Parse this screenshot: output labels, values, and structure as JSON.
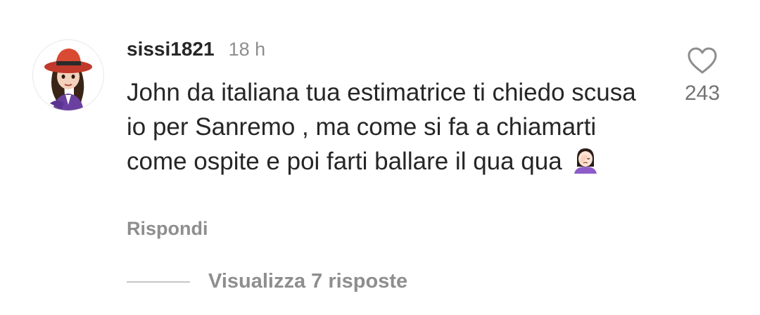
{
  "comment": {
    "avatar_icon": "user-avatar-cartoon-woman-red-hat",
    "username": "sissi1821",
    "timestamp": "18 h",
    "text": "John da italiana tua estimatrice ti chiedo scusa io per Sanremo , ma come si fa a chiamarti come ospite e poi farti ballare il qua qua",
    "emoji": "🤦🏻‍♀️",
    "emoji_icon": "woman-facepalming-icon",
    "reply_label": "Rispondi",
    "like_icon": "heart-outline-icon",
    "like_count": "243",
    "view_replies_label": "Visualizza 7 risposte"
  },
  "colors": {
    "primary_text": "#262626",
    "secondary_text": "#8e8e8e",
    "like_count": "#737373",
    "divider": "#c7c7c7"
  }
}
